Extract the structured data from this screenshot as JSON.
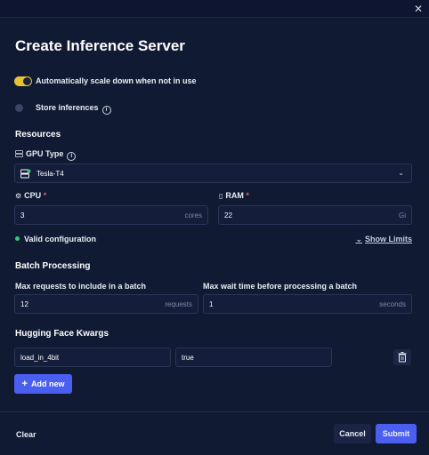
{
  "dialog": {
    "title": "Create Inference Server"
  },
  "autoscale": {
    "label": "Automatically scale down when not in use",
    "enabled": true
  },
  "store": {
    "label": "Store inferences",
    "enabled": false
  },
  "resources": {
    "heading": "Resources",
    "gpu": {
      "label": "GPU Type",
      "value": "Tesla-T4"
    },
    "cpu": {
      "label": "CPU",
      "required": "*",
      "value": "3",
      "unit": "cores"
    },
    "ram": {
      "label": "RAM",
      "required": "*",
      "value": "22",
      "unit": "Gi"
    },
    "status": "Valid configuration",
    "show_limits": "Show Limits"
  },
  "batch": {
    "heading": "Batch Processing",
    "max_requests": {
      "label": "Max requests to include in a batch",
      "value": "12",
      "unit": "requests"
    },
    "max_wait": {
      "label": "Max wait time before processing a batch",
      "value": "1",
      "unit": "seconds"
    }
  },
  "kwargs": {
    "heading": "Hugging Face Kwargs",
    "rows": [
      {
        "key": "load_in_4bit",
        "value": "true"
      }
    ],
    "add_label": "Add new"
  },
  "footer": {
    "clear": "Clear",
    "cancel": "Cancel",
    "submit": "Submit"
  },
  "colors": {
    "accent": "#4a5ff0",
    "toggle": "#e6c233",
    "valid": "#34c774",
    "background": "#111a33"
  }
}
